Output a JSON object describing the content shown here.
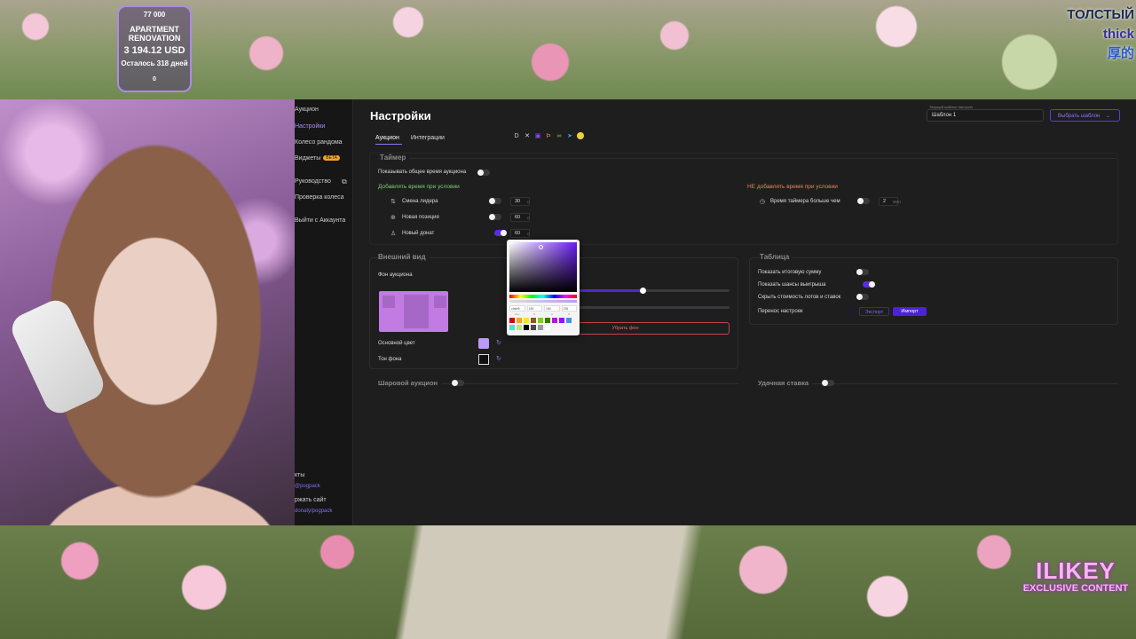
{
  "overlay": {
    "top_right_lines": [
      "ТОЛСТЫЙ",
      "thick",
      "厚的"
    ],
    "goal": {
      "count": "77 000",
      "title": "APARTMENT RENOVATION",
      "amount": "3 194.12 USD",
      "remaining": "Осталось 318 дней",
      "progress": "0"
    },
    "logo": {
      "line1": "ILIKEY",
      "line2": "EXCLUSIVE CONTENT"
    }
  },
  "sidebar": {
    "items": [
      {
        "label": "Аукцион",
        "active": false
      },
      {
        "label": "Настройки",
        "active": true
      },
      {
        "label": "Колесо рандома",
        "active": false
      },
      {
        "label": "Виджеты",
        "active": false,
        "badge": "BETA"
      },
      {
        "label": "Руководство",
        "active": false
      },
      {
        "label": "Проверка колеса",
        "active": false
      },
      {
        "label": "Выйти с Аккаунта",
        "active": false
      }
    ],
    "bottom": {
      "contacts": "кты",
      "contact_handle": "@pogpack",
      "support": "ржать сайт",
      "support_handle": "donaty/pogpack"
    }
  },
  "header": {
    "title": "Настройки",
    "template_label": "Текущий шаблон настроек",
    "template_value": "Шаблон 1",
    "template_button": "Выбрать шаблон"
  },
  "tabs": [
    {
      "label": "Аукцион",
      "active": true
    },
    {
      "label": "Интеграции",
      "active": false
    }
  ],
  "integration_icons": [
    "da-icon",
    "x-icon",
    "twitch-icon",
    "donatepay-icon",
    "donationalerts-icon",
    "telegram-icon",
    "tg-icon"
  ],
  "timer": {
    "title": "Таймер",
    "show_total_label": "Показывать общее время аукциона",
    "add_time_label": "Добавлять время при условии",
    "no_add_time_label": "НЕ добавлять время при условии",
    "rows": [
      {
        "label": "Смена лидера",
        "value": "30",
        "unit": "с"
      },
      {
        "label": "Новая позиция",
        "value": "60",
        "unit": "с"
      },
      {
        "label": "Новый донат",
        "value": "60",
        "unit": "с"
      }
    ],
    "condition": {
      "label": "Время таймера больше чем",
      "value": "2",
      "unit": "мин"
    }
  },
  "appearance": {
    "title": "Внешний вид",
    "bg_label": "Фон аукциона",
    "remove_bg": "Убрать фон",
    "main_color_label": "Основной цвет",
    "bg_tone_label": "Тон фона",
    "main_color": "#b89cf5",
    "bg_tone_color": "#111111",
    "slider1_level": 0.48,
    "slider2_level": 0.02
  },
  "picker": {
    "fields": [
      "cfabf6",
      "183",
      "160",
      "235"
    ],
    "field_labels": [
      "Hex",
      "R",
      "G",
      "B"
    ],
    "presets": [
      "#d0021b",
      "#f5a623",
      "#f8e71c",
      "#8b572a",
      "#7ed321",
      "#417505",
      "#bd10e0",
      "#9013fe",
      "#4a90e2",
      "#50e3c2",
      "#b8e986",
      "#000000",
      "#4a4a4a",
      "#9b9b9b",
      "#ffffff"
    ]
  },
  "table": {
    "title": "Таблица",
    "show_total": "Показать итоговую сумму",
    "show_chances": "Показать шансы выигрыша",
    "hide_costs": "Скрыть стоимость лотов и ставок",
    "transfer": "Перенос настроек",
    "export": "Экспорт",
    "import": "Импорт"
  },
  "ball_auction": {
    "title": "Шаровой аукцион"
  },
  "lucky_bet": {
    "title": "Удачная ставка"
  }
}
